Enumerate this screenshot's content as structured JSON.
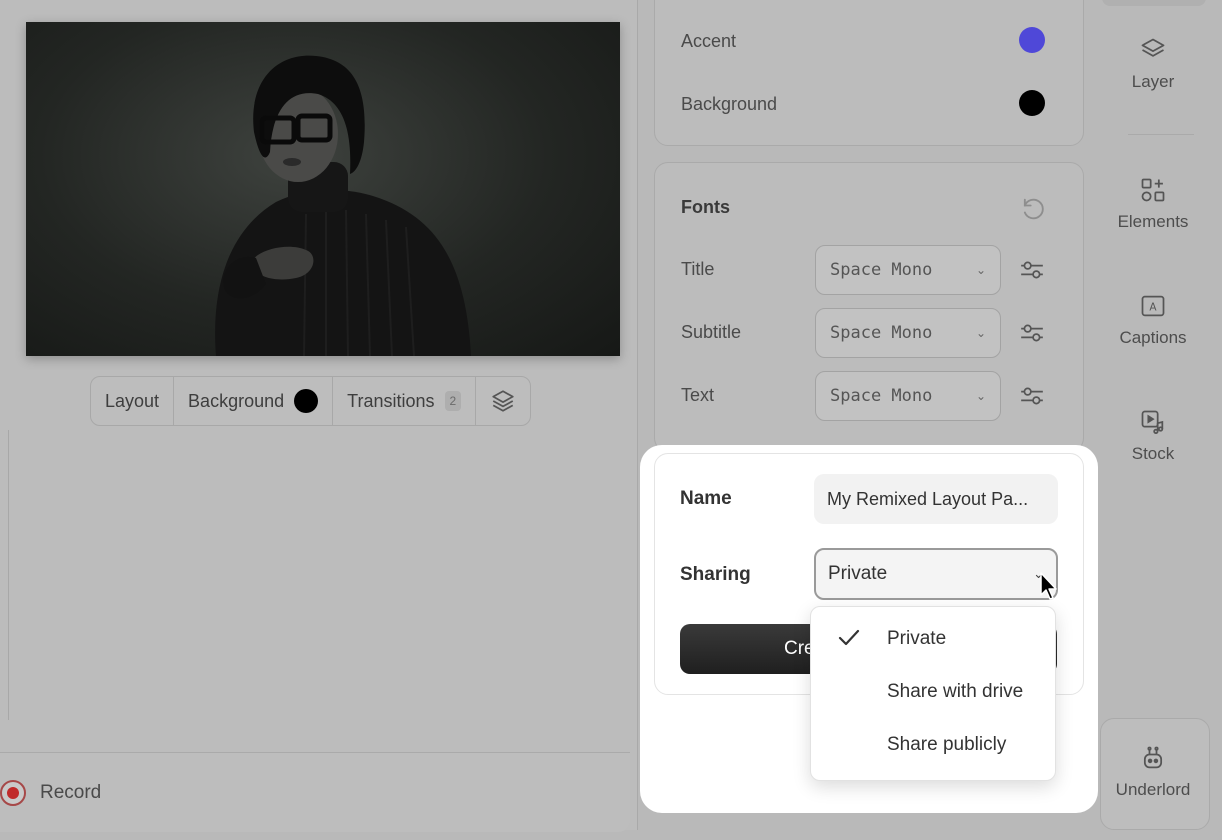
{
  "preview_toolbar": {
    "layout": "Layout",
    "background": "Background",
    "background_color": "#000000",
    "transitions": "Transitions",
    "transitions_count": "2"
  },
  "record": {
    "label": "Record"
  },
  "colors": {
    "accent_label": "Accent",
    "accent_color": "#4f48d8",
    "background_label": "Background",
    "background_color": "#000000"
  },
  "fonts": {
    "title": "Fonts",
    "rows": [
      {
        "label": "Title",
        "font": "Space Mono"
      },
      {
        "label": "Subtitle",
        "font": "Space Mono"
      },
      {
        "label": "Text",
        "font": "Space Mono"
      }
    ]
  },
  "side_nav": {
    "layer": "Layer",
    "elements": "Elements",
    "captions": "Captions",
    "stock": "Stock",
    "underlord": "Underlord"
  },
  "modal": {
    "name_label": "Name",
    "name_value": "My Remixed Layout Pa...",
    "sharing_label": "Sharing",
    "sharing_value": "Private",
    "create_label": "Cre",
    "sharing_options": [
      {
        "label": "Private",
        "selected": true
      },
      {
        "label": "Share with drive",
        "selected": false
      },
      {
        "label": "Share publicly",
        "selected": false
      }
    ]
  }
}
